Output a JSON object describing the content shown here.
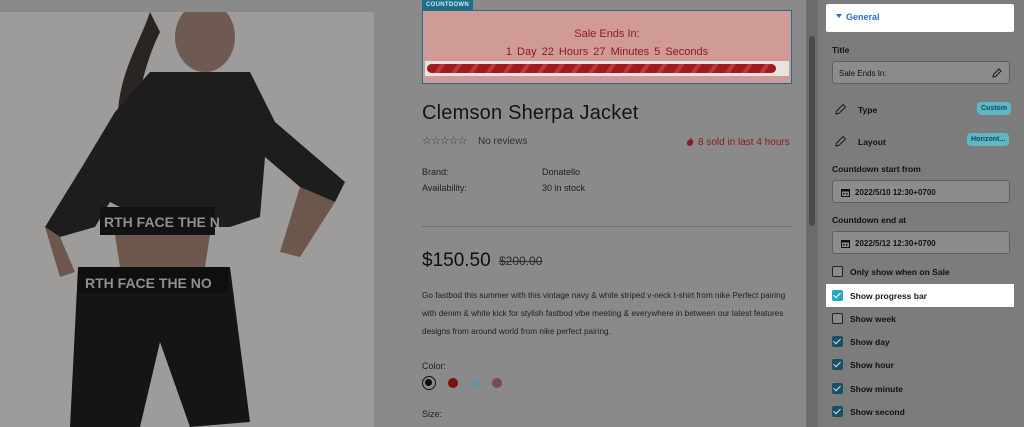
{
  "countdown": {
    "tag": "COUNTDOWN",
    "title": "Sale Ends In:",
    "timer": "1 Day   22 Hours   27 Minutes   5 Seconds",
    "progress": 0.97,
    "accent_color": "#8b1a1a"
  },
  "product": {
    "title": "Clemson Sherpa Jacket",
    "stars": "☆☆☆☆☆",
    "reviews": "No reviews",
    "sold": "8 sold in last 4 hours",
    "brand_label": "Brand:",
    "brand_value": "Donatello",
    "availability_label": "Availability:",
    "availability_value": "30 in stock",
    "price": "$150.50",
    "old_price": "$200.00",
    "description": "Go fastbod this summer with this vintage navy & white striped v-neck t-shirt from nike Perfect pairing with denim & white kick for stylish fastbod vibe meeting & everywhere in between our latest features designs from around world from nike perfect pairing.",
    "color_label": "Color:",
    "colors": [
      "#0c0c0c",
      "#7a1414",
      "#6f8e9e",
      "#7a4a58"
    ],
    "size_label": "Size:"
  },
  "panel": {
    "section": "General",
    "title_label": "Title",
    "title_value": "Sale Ends In:",
    "type_label": "Type",
    "type_value": "Custom",
    "layout_label": "Layout",
    "layout_value": "Horizont...",
    "start_label": "Countdown start from",
    "start_value": "2022/5/10 12:30+0700",
    "end_label": "Countdown end at",
    "end_value": "2022/5/12 12:30+0700",
    "options": [
      {
        "label": "Only show when on Sale",
        "checked": false
      },
      {
        "label": "Show progress bar",
        "checked": true
      },
      {
        "label": "Show week",
        "checked": false
      },
      {
        "label": "Show day",
        "checked": true
      },
      {
        "label": "Show hour",
        "checked": true
      },
      {
        "label": "Show minute",
        "checked": true
      },
      {
        "label": "Show second",
        "checked": true
      }
    ]
  }
}
